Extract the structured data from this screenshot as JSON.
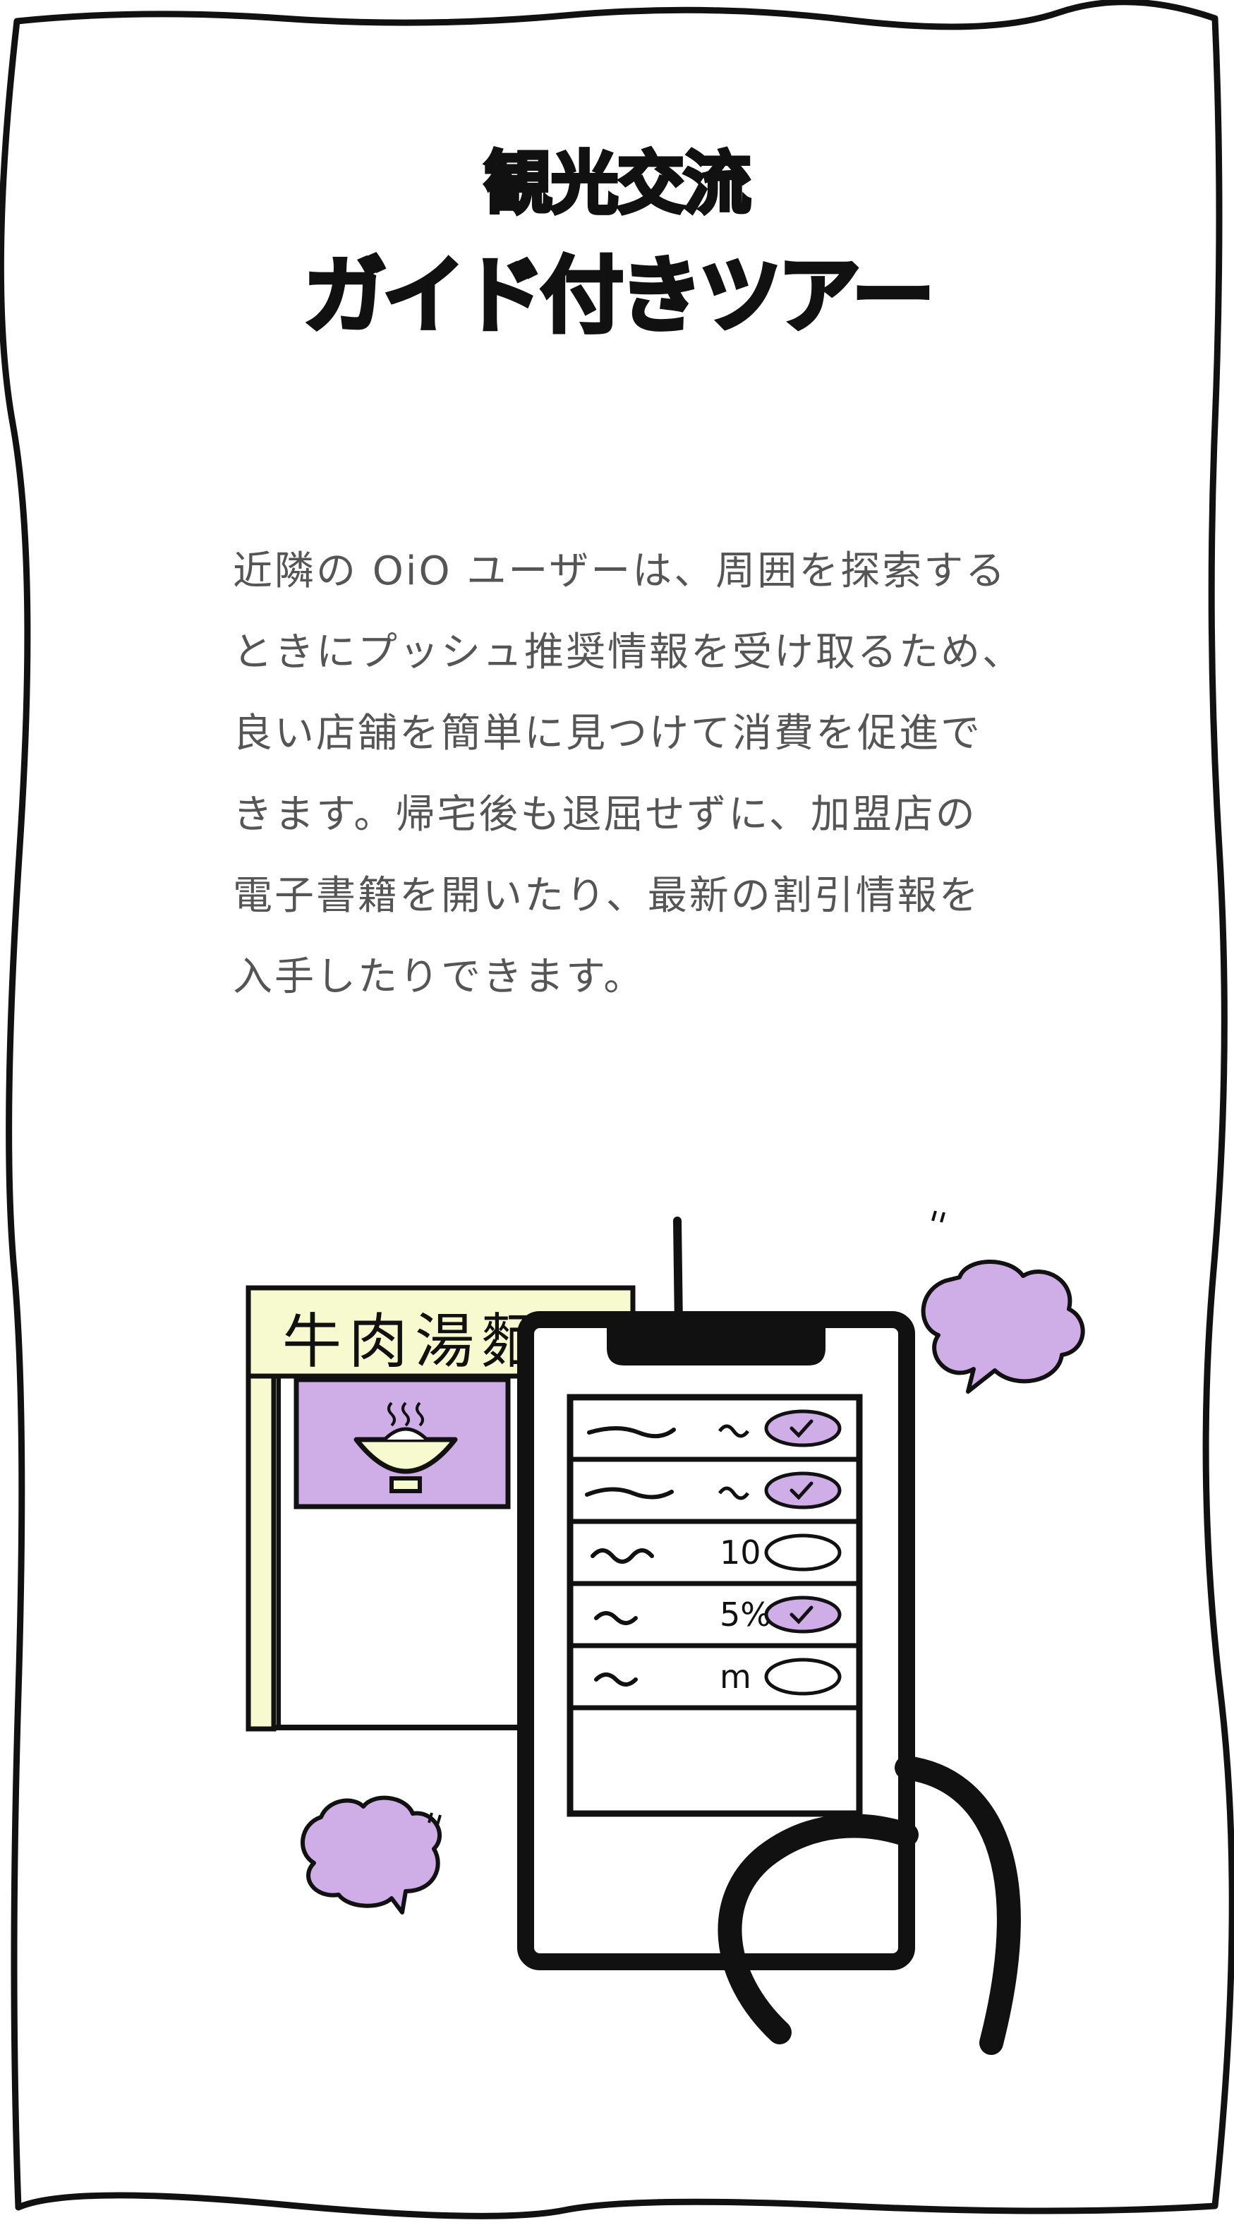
{
  "title": {
    "line1": "観光交流",
    "line2": "ガイド付きツアー"
  },
  "description": {
    "lines": [
      "近隣の OiO ユーザーは、周囲を探索する",
      "ときにプッシュ推奨情報を受け取るため、",
      "良い店舗を簡単に見つけて消費を促進で",
      "きます。帰宅後も退屈せずに、加盟店の",
      "電子書籍を開いたり、最新の割引情報を",
      "入手したりできます。"
    ]
  },
  "illustration": {
    "shop_sign": "牛肉湯麵",
    "phone_rows": [
      {
        "label": "",
        "checked": true
      },
      {
        "label": "",
        "checked": true
      },
      {
        "label": "10",
        "checked": false
      },
      {
        "label": "5%",
        "checked": true
      },
      {
        "label": "m",
        "checked": false
      }
    ],
    "colors": {
      "accent_purple": "#cfaee8",
      "sign_yellow": "#f7f9cf",
      "ink": "#111111"
    },
    "icons": [
      "noodle-bowl-icon",
      "checkmark-icon",
      "speech-cloud-icon"
    ]
  }
}
